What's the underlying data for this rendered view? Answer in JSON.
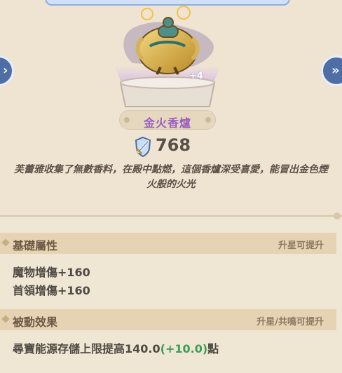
{
  "item": {
    "name": "金火香爐",
    "power": "768",
    "star_bonus": "+4",
    "description": "芙蕾雅收集了無數香料，在殿中點燃，這個香爐深受喜愛，能冒出金色煙火般的火光"
  },
  "nav": {
    "left_icon": "chevron-left-icon",
    "right_icon": "chevron-right-icon"
  },
  "sections": {
    "basic": {
      "title": "基礎屬性",
      "hint": "升星可提升",
      "stats": [
        "魔物增傷+160",
        "首領增傷+160"
      ]
    },
    "passive": {
      "title": "被動效果",
      "hint": "升星/共鳴可提升",
      "effect_prefix": "尋寶能源存儲上限提高140.0",
      "effect_bonus": "(+10.0)",
      "effect_suffix": "點"
    }
  },
  "colors": {
    "item_name": "#9a5fbe",
    "bonus_green": "#3d9d57",
    "section_header": "#e6d3b3"
  }
}
